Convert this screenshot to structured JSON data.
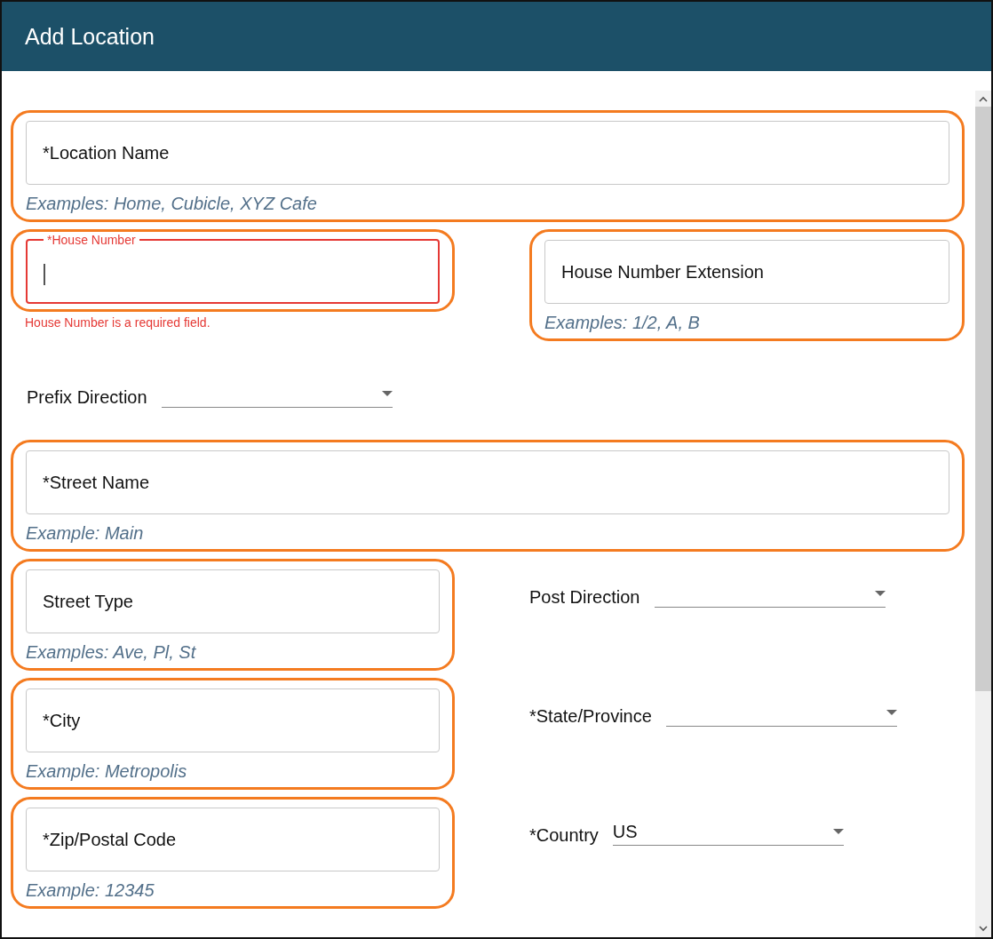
{
  "window": {
    "title": "Add Location"
  },
  "rows": [
    {
      "cells": [
        {
          "kind": "text",
          "label": "*Location Name",
          "hint": "Examples: Home, Cubicle, XYZ Cafe",
          "highlighted": true,
          "error": false,
          "focused": false
        }
      ]
    },
    {
      "cells": [
        {
          "kind": "text",
          "label": "*House Number",
          "error_message": "House Number is a required field.",
          "highlighted": true,
          "error": true,
          "focused": true
        },
        {
          "kind": "text",
          "label": "House Number Extension",
          "hint": "Examples: 1/2, A, B",
          "highlighted": true,
          "error": false,
          "focused": false
        }
      ]
    },
    {
      "cells": [
        {
          "kind": "select",
          "label": "Prefix Direction"
        }
      ]
    },
    {
      "cells": [
        {
          "kind": "text",
          "label": "*Street Name",
          "hint": "Example: Main",
          "highlighted": true,
          "error": false,
          "focused": false
        }
      ]
    },
    {
      "cells": [
        {
          "kind": "text",
          "label": "Street Type",
          "hint": "Examples: Ave, Pl, St",
          "highlighted": true,
          "error": false,
          "focused": false
        },
        {
          "kind": "select",
          "label": "Post Direction"
        }
      ]
    },
    {
      "cells": [
        {
          "kind": "text",
          "label": "*City",
          "hint": "Example: Metropolis",
          "highlighted": true,
          "error": false,
          "focused": false
        },
        {
          "kind": "select",
          "label": "*State/Province"
        }
      ]
    },
    {
      "cells": [
        {
          "kind": "text",
          "label": "*Zip/Postal Code",
          "hint": "Example: 12345",
          "highlighted": true,
          "error": false,
          "focused": false
        },
        {
          "kind": "select",
          "label": "*Country",
          "value": "US"
        }
      ]
    }
  ]
}
